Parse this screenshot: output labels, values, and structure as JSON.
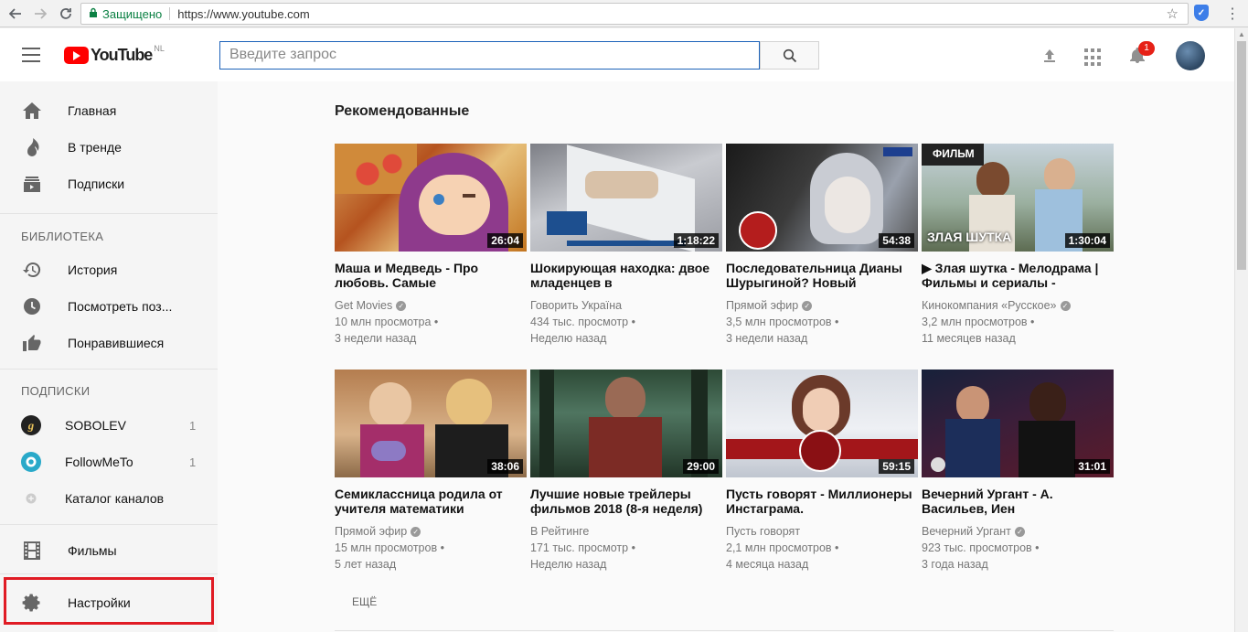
{
  "browser": {
    "secure_label": "Защищено",
    "url": "https://www.youtube.com"
  },
  "header": {
    "logo_text": "YouTube",
    "region": "NL",
    "search_placeholder": "Введите запрос",
    "notifications_count": "1"
  },
  "sidebar": {
    "main_items": [
      {
        "label": "Главная",
        "icon": "home-icon"
      },
      {
        "label": "В тренде",
        "icon": "fire-icon"
      },
      {
        "label": "Подписки",
        "icon": "subscriptions-icon"
      }
    ],
    "library_header": "БИБЛИОТЕКА",
    "library_items": [
      {
        "label": "История",
        "icon": "history-icon"
      },
      {
        "label": "Посмотреть поз...",
        "icon": "clock-icon"
      },
      {
        "label": "Понравившиеся",
        "icon": "thumbs-up-icon"
      }
    ],
    "subs_header": "ПОДПИСКИ",
    "subs_items": [
      {
        "label": "SOBOLEV",
        "count": "1"
      },
      {
        "label": "FollowMeTo",
        "count": "1"
      },
      {
        "label": "Каталог каналов",
        "count": ""
      }
    ],
    "bottom_items": [
      {
        "label": "Фильмы",
        "icon": "film-icon"
      },
      {
        "label": "Настройки",
        "icon": "gear-icon"
      }
    ]
  },
  "main": {
    "section_title": "Рекомендованные",
    "more_label": "ЕЩЁ",
    "videos": [
      {
        "title": "Маша и Медведь - Про любовь. Самые",
        "channel": "Get Movies",
        "verified": true,
        "views": "10 млн просмотра •",
        "age": "3 недели назад",
        "duration": "26:04"
      },
      {
        "title": "Шокирующая находка: двое младенцев в",
        "channel": "Говорить Україна",
        "verified": false,
        "views": "434 тыс. просмотр •",
        "age": "Неделю назад",
        "duration": "1:18:22"
      },
      {
        "title": "Последовательница Дианы Шурыгиной? Новый",
        "channel": "Прямой эфир",
        "verified": true,
        "views": "3,5 млн просмотров •",
        "age": "3 недели назад",
        "duration": "54:38"
      },
      {
        "title": "▶ Злая шутка - Мелодрама | Фильмы и сериалы -",
        "channel": "Кинокомпания «Русское»",
        "verified": true,
        "views": "3,2 млн просмотров •",
        "age": "11 месяцев назад",
        "duration": "1:30:04",
        "thumb_label_top": "ФИЛЬМ",
        "thumb_label_bottom": "ЗЛАЯ ШУТКА"
      },
      {
        "title": "Семиклассница родила от учителя математики",
        "channel": "Прямой эфир",
        "verified": true,
        "views": "15 млн просмотров •",
        "age": "5 лет назад",
        "duration": "38:06"
      },
      {
        "title": "Лучшие новые трейлеры фильмов 2018 (8-я неделя)",
        "channel": "В Рейтинге",
        "verified": false,
        "views": "171 тыс. просмотр •",
        "age": "Неделю назад",
        "duration": "29:00"
      },
      {
        "title": "Пусть говорят - Миллионеры Инстаграма.",
        "channel": "Пусть говорят",
        "verified": false,
        "views": "2,1 млн просмотров •",
        "age": "4 месяца назад",
        "duration": "59:15"
      },
      {
        "title": "Вечерний Ургант - А. Васильев, Иен",
        "channel": "Вечерний Ургант",
        "verified": true,
        "views": "923 тыс. просмотров •",
        "age": "3 года назад",
        "duration": "31:01"
      }
    ]
  },
  "colors": {
    "brand_red": "#ff0000",
    "badge_red": "#e62117",
    "highlight_frame": "#e01b24",
    "search_border": "#1c62b9"
  }
}
